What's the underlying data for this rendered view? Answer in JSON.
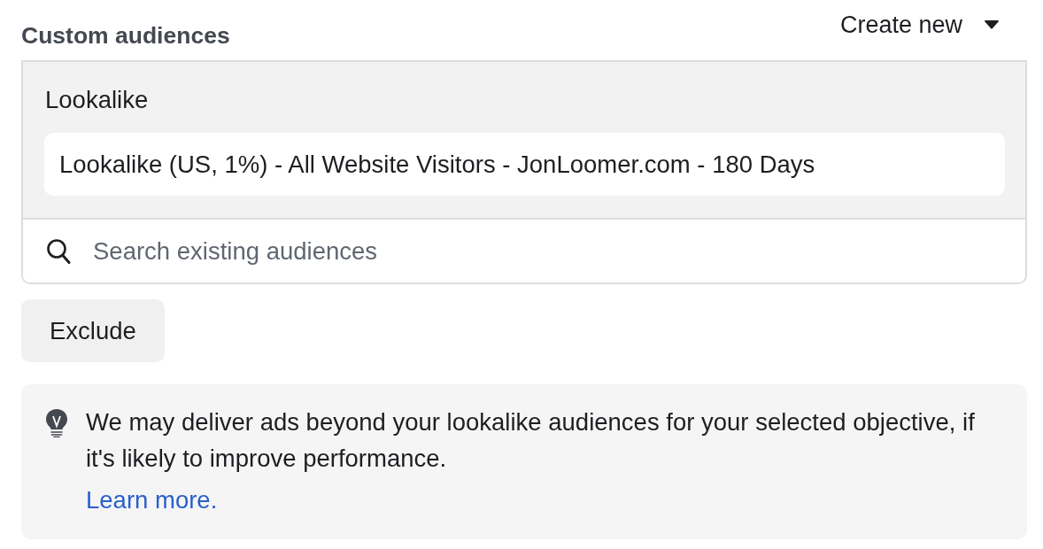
{
  "header": {
    "title": "Custom audiences",
    "create_menu": {
      "label": "Create new"
    }
  },
  "audience_selector": {
    "groups": [
      {
        "label": "Lookalike",
        "audiences": [
          "Lookalike (US, 1%) - All Website Visitors - JonLoomer.com - 180 Days"
        ]
      }
    ],
    "search": {
      "placeholder": "Search existing audiences"
    }
  },
  "exclude_button": {
    "label": "Exclude"
  },
  "notice": {
    "text": "We may deliver ads beyond your lookalike audiences for your selected objective, if it's likely to improve performance.",
    "link": "Learn more."
  }
}
